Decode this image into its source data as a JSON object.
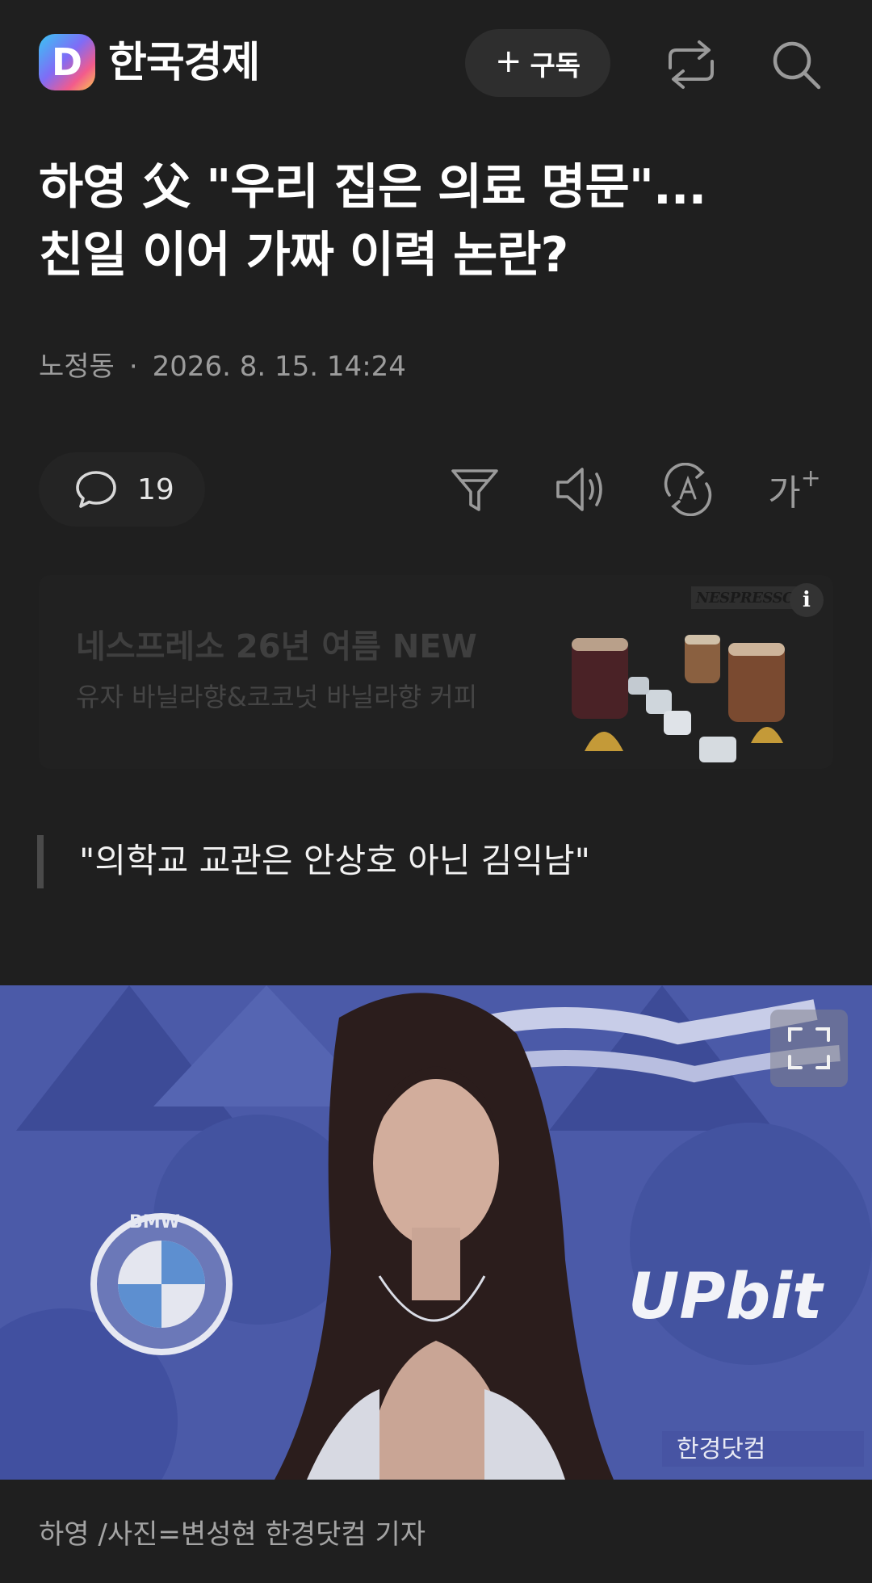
{
  "header": {
    "logo_letter": "D",
    "press_name": "한국경제",
    "subscribe_label": "구독",
    "subscribe_icon": "plus-icon",
    "share_icon": "share-icon",
    "search_icon": "search-icon"
  },
  "article": {
    "headline_line1": "하영 父 \"우리 집은 의료 명문\"...",
    "headline_line2": "친일 이어 가짜 이력 논란?",
    "author": "노정동",
    "date": "2026. 8. 15. 14:24",
    "subheading": "\"의학교 교관은 안상호 아닌 김익남\"",
    "photo_caption": "하영 /사진=변성현 한경닷컴 기자"
  },
  "toolbar": {
    "comment_count": "19",
    "comment_icon": "speech-bubble-icon",
    "summary_icon": "funnel-icon",
    "tts_icon": "speaker-icon",
    "translate_icon": "translate-icon",
    "font_size_label": "가"
  },
  "ad": {
    "title": "네스프레소 26년 여름 NEW",
    "subtitle": "유자 바닐라향&코코넛 바닐라향 커피",
    "brand": "NESPRESSO",
    "info_icon": "i"
  },
  "photo": {
    "sponsor_left": "BMW",
    "sponsor_right": "UPbit",
    "watermark": "한경닷컴",
    "expand_icon": "expand-icon"
  },
  "colors": {
    "background": "#1f1f1f",
    "photo_backdrop": "#4b5aa8",
    "muted_text": "#9c9c9c"
  }
}
